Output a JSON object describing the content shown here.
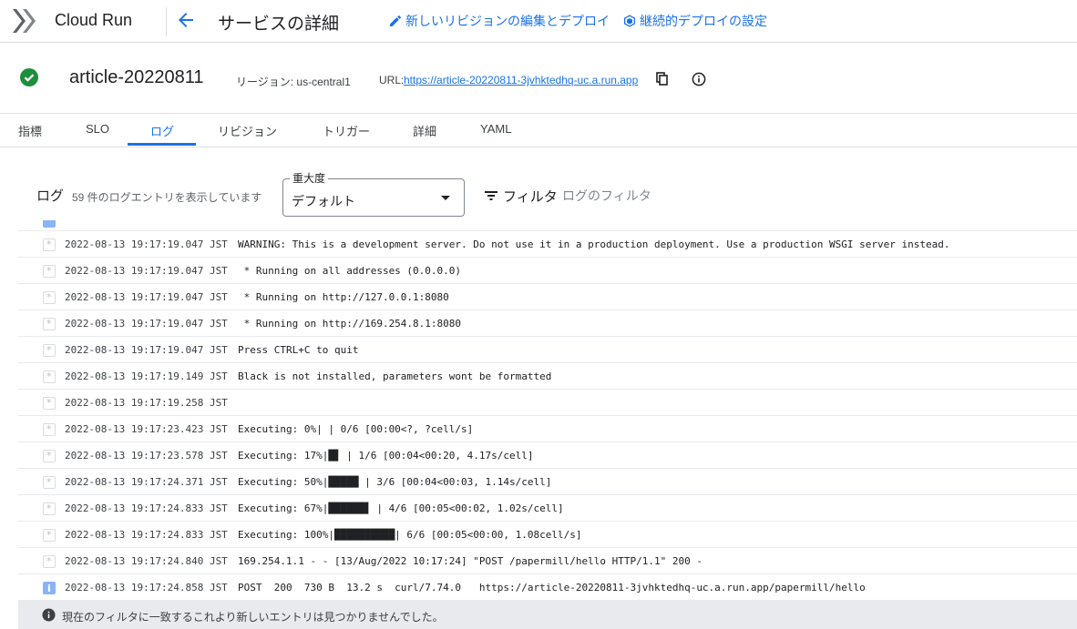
{
  "app": {
    "product_name": "Cloud Run"
  },
  "header": {
    "title": "サービスの詳細",
    "edit_deploy_label": "新しいリビジョンの編集とデプロイ",
    "continuous_deploy_label": "継続的デプロイの設定"
  },
  "service": {
    "name": "article-20220811",
    "region_text": "リージョン: us-central1",
    "url_label": "URL:",
    "url": "https://article-20220811-3jvhktedhq-uc.a.run.app"
  },
  "tabs": [
    {
      "label": "指標"
    },
    {
      "label": "SLO"
    },
    {
      "label": "ログ",
      "active": true
    },
    {
      "label": "リビジョン"
    },
    {
      "label": "トリガー"
    },
    {
      "label": "詳細"
    },
    {
      "label": "YAML"
    }
  ],
  "logs": {
    "heading": "ログ",
    "count_text": "59 件のログエントリを表示しています",
    "severity_label": "重大度",
    "severity_value": "デフォルト",
    "filter_label": "フィルタ",
    "filter_placeholder": "ログのフィルタ",
    "entries": [
      {
        "severity": "default",
        "timestamp": "2022-08-13 19:17:19.047 JST",
        "message": "WARNING: This is a development server. Do not use it in a production deployment. Use a production WSGI server instead."
      },
      {
        "severity": "default",
        "timestamp": "2022-08-13 19:17:19.047 JST",
        "message": " * Running on all addresses (0.0.0.0)"
      },
      {
        "severity": "default",
        "timestamp": "2022-08-13 19:17:19.047 JST",
        "message": " * Running on http://127.0.0.1:8080"
      },
      {
        "severity": "default",
        "timestamp": "2022-08-13 19:17:19.047 JST",
        "message": " * Running on http://169.254.8.1:8080"
      },
      {
        "severity": "default",
        "timestamp": "2022-08-13 19:17:19.047 JST",
        "message": "Press CTRL+C to quit"
      },
      {
        "severity": "default",
        "timestamp": "2022-08-13 19:17:19.149 JST",
        "message": "Black is not installed, parameters wont be formatted"
      },
      {
        "severity": "default",
        "timestamp": "2022-08-13 19:17:19.258 JST",
        "message": ""
      },
      {
        "severity": "default",
        "timestamp": "2022-08-13 19:17:23.423 JST",
        "message": "Executing: 0%| | 0/6 [00:00<?, ?cell/s]"
      },
      {
        "severity": "default",
        "timestamp": "2022-08-13 19:17:23.578 JST",
        "message": "Executing: 17%|█▋ | 1/6 [00:04<00:20, 4.17s/cell]"
      },
      {
        "severity": "default",
        "timestamp": "2022-08-13 19:17:24.371 JST",
        "message": "Executing: 50%|█████ | 3/6 [00:04<00:03, 1.14s/cell]"
      },
      {
        "severity": "default",
        "timestamp": "2022-08-13 19:17:24.833 JST",
        "message": "Executing: 67%|██████▋ | 4/6 [00:05<00:02, 1.02s/cell]"
      },
      {
        "severity": "default",
        "timestamp": "2022-08-13 19:17:24.833 JST",
        "message": "Executing: 100%|██████████| 6/6 [00:05<00:00, 1.08cell/s]"
      },
      {
        "severity": "default",
        "timestamp": "2022-08-13 19:17:24.840 JST",
        "message": "169.254.1.1 - - [13/Aug/2022 10:17:24] \"POST /papermill/hello HTTP/1.1\" 200 -"
      },
      {
        "severity": "info",
        "timestamp": "2022-08-13 19:17:24.858 JST",
        "message": "POST  200  730 B  13.2 s  curl/7.74.0   https://article-20220811-3jvhktedhq-uc.a.run.app/papermill/hello"
      }
    ],
    "no_more_text": "現在のフィルタに一致するこれより新しいエントリは見つかりませんでした。"
  },
  "colors": {
    "accent": "#1a73e8",
    "success": "#1e8e3e",
    "info_badge": "#8ab4f8"
  }
}
